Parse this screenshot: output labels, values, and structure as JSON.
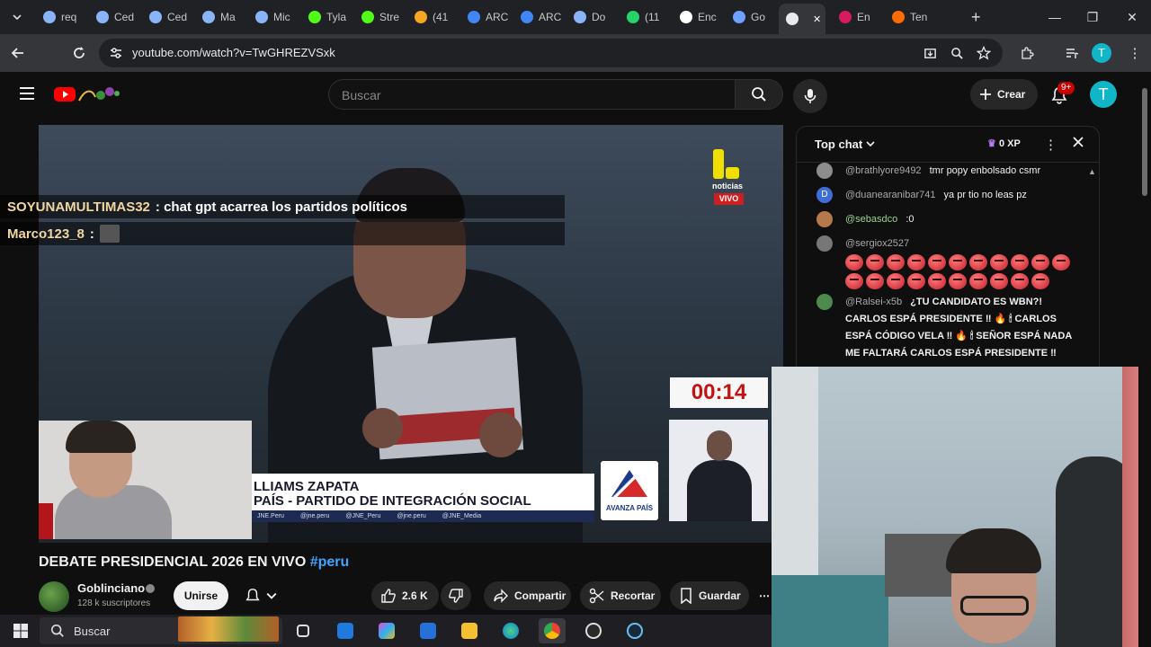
{
  "browser": {
    "tabs": [
      {
        "label": "req",
        "icon": "globe-icon",
        "color": "#8ab4f8"
      },
      {
        "label": "Ced",
        "icon": "globe-icon",
        "color": "#8ab4f8"
      },
      {
        "label": "Ced",
        "icon": "globe-icon",
        "color": "#8ab4f8"
      },
      {
        "label": "Ma",
        "icon": "globe-icon",
        "color": "#8ab4f8"
      },
      {
        "label": "Mic",
        "icon": "globe-icon",
        "color": "#8ab4f8"
      },
      {
        "label": "Tyla",
        "icon": "kick-icon",
        "color": "#53fc18"
      },
      {
        "label": "Stre",
        "icon": "kick-icon",
        "color": "#53fc18"
      },
      {
        "label": "(41",
        "icon": "app-icon",
        "color": "#f6a623"
      },
      {
        "label": "ARC",
        "icon": "docs-icon",
        "color": "#4285f4"
      },
      {
        "label": "ARC",
        "icon": "docs-icon",
        "color": "#4285f4"
      },
      {
        "label": "Do",
        "icon": "globe-icon",
        "color": "#8ab4f8"
      },
      {
        "label": "(11",
        "icon": "whatsapp-icon",
        "color": "#25d366"
      },
      {
        "label": "Enc",
        "icon": "tiktok-icon",
        "color": "#ffffff"
      },
      {
        "label": "Go",
        "icon": "gemini-icon",
        "color": "#6ea0ff"
      },
      {
        "label": "",
        "icon": "audio-icon",
        "color": "#e8eaed"
      },
      {
        "label": "En",
        "icon": "app-icon",
        "color": "#d81b60"
      },
      {
        "label": "Ten",
        "icon": "app-icon",
        "color": "#ff6d00"
      }
    ],
    "new_tab": "+",
    "url": "youtube.com/watch?v=TwGHREZVSxk"
  },
  "youtube": {
    "search_placeholder": "Buscar",
    "create_label": "Crear",
    "notifications_badge": "9+",
    "avatar_letter": "T"
  },
  "video": {
    "overlay_chat": [
      {
        "user": "SOYUNAMULTIMAS32",
        "message": ": chat gpt acarrea los partidos políticos"
      },
      {
        "user": "Marco123_8",
        "message": ":"
      }
    ],
    "news_logo_name": "noticias",
    "news_logo_live": "VIVO",
    "timer": "00:14",
    "lower_third_name": "LLIAMS ZAPATA",
    "lower_third_party": "PAÍS - PARTIDO DE INTEGRACIÓN SOCIAL",
    "social_handles": [
      "JNE.Peru",
      "@jne.peru",
      "@JNE_Peru",
      "@jne.peru",
      "@JNE_Media"
    ],
    "party_logo_text": "AVANZA PAÍS",
    "title": "DEBATE PRESIDENCIAL 2026 EN VIVO",
    "title_tag": "#peru",
    "channel_name": "Goblinciano",
    "channel_subs": "128 k suscriptores",
    "join_label": "Unirse",
    "like_count": "2.6 K",
    "share_label": "Compartir",
    "clip_label": "Recortar",
    "save_label": "Guardar"
  },
  "chat": {
    "title": "Top chat",
    "xp": "0 XP",
    "messages": [
      {
        "user": "@brathlyore9492",
        "text": "tmr popy enbolsado csmr",
        "avatar_color": "#8d8d8d"
      },
      {
        "user": "@duanearanibar741",
        "text": "ya pr tio no leas pz",
        "avatar_color": "#3f6fd6",
        "avatar_letter": "D"
      },
      {
        "user": "@sebasdco",
        "text": ":0",
        "avatar_color": "#b57a4a",
        "green": true
      },
      {
        "user": "@sergiox2527",
        "text": "",
        "avatar_color": "#777777"
      },
      {
        "user": "@Ralsei-x5b",
        "text": "¿TU CANDIDATO ES WBN?! CARLOS ESPÁ PRESIDENTE ‼ 🔥 🕯 CARLOS ESPÁ CÓDIGO VELA ‼ 🔥 🕯 SEÑOR ESPÁ NADA ME FALTARÁ CARLOS ESPÁ PRESIDENTE ‼",
        "avatar_color": "#4d8a4d"
      }
    ]
  },
  "taskbar": {
    "search_placeholder": "Buscar"
  }
}
